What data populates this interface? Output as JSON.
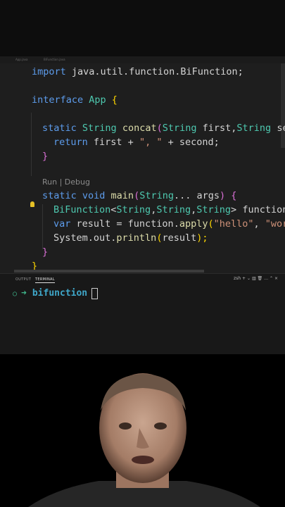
{
  "tabs": [
    "App.java",
    "BiFunction.java"
  ],
  "editor": {
    "line1": {
      "kw": "import",
      "rest": " java.util.function.BiFunction;"
    },
    "line2": {
      "kw": "interface",
      "name": " App ",
      "brace": "{"
    },
    "line3": {
      "kw": "static",
      "type": " String",
      "fn": " concat",
      "open": "(",
      "p1type": "String",
      "p1": " first,",
      "p2type": "String",
      "p2": " se"
    },
    "line4": {
      "kw": "return",
      "a": " first + ",
      "s": "\", \"",
      "b": " + second;"
    },
    "line5": {
      "brace": "}"
    },
    "codelens": {
      "run": "Run",
      "sep": " | ",
      "debug": "Debug"
    },
    "line6": {
      "kw1": "static",
      "kw2": " void",
      "fn": " main",
      "open": "(",
      "ptype": "String",
      "p": "... args",
      "close": ")",
      "brace": " {"
    },
    "line7": {
      "type": "BiFunction",
      "lt": "<",
      "g1": "String",
      "c1": ",",
      "g2": "String",
      "c2": ",",
      "g3": "String",
      "gt": ">",
      "rest": " function"
    },
    "line8": {
      "kw": "var",
      "a": " result = function.",
      "fn": "apply",
      "open": "(",
      "s1": "\"hello\"",
      "c": ", ",
      "s2": "\"wor"
    },
    "line9": {
      "a": "System.out.",
      "fn": "println",
      "open": "(",
      "arg": "result",
      "close": ");"
    },
    "line10": {
      "brace": "}"
    },
    "line11": {
      "brace": "}"
    }
  },
  "panel": {
    "tab_output": "OUTPUT",
    "tab_terminal": "TERMINAL",
    "shell": "zsh",
    "prompt_arrow": "➜",
    "prompt_dir": "bifunction"
  },
  "colors": {
    "keyword": "#5d9cec",
    "type": "#4ec9b0",
    "function": "#dcdcaa",
    "string": "#ce9178",
    "editor_bg": "#1e1e1e",
    "terminal_bg": "#181818"
  }
}
